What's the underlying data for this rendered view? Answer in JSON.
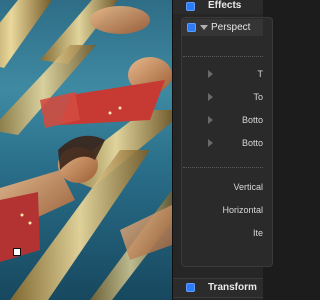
{
  "inspector": {
    "effects_label": "Effects",
    "effect_name": "Perspect",
    "params": [
      {
        "label": "T"
      },
      {
        "label": "To"
      },
      {
        "label": "Botto"
      },
      {
        "label": "Botto"
      }
    ],
    "settings": [
      {
        "label": "Vertical"
      },
      {
        "label": "Horizontal"
      },
      {
        "label": "Ite"
      }
    ],
    "transform_label": "Transform"
  },
  "colors": {
    "accent": "#2f7bf6",
    "panel": "#262626"
  }
}
